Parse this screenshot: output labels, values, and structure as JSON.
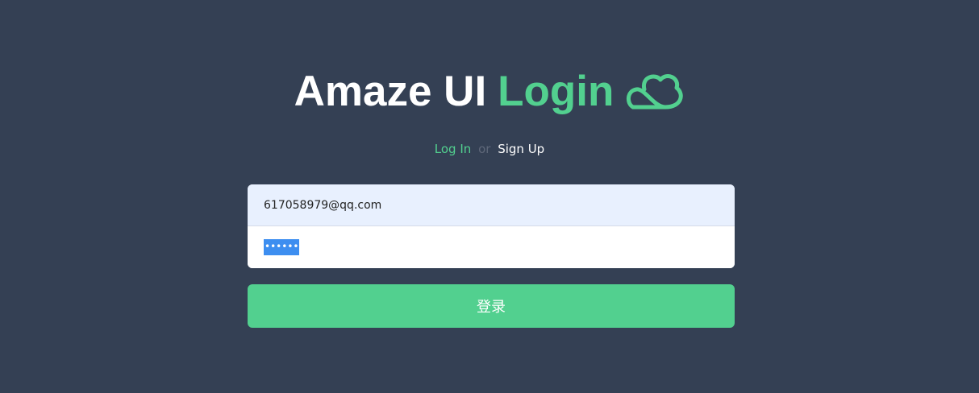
{
  "header": {
    "title_main": "Amaze UI",
    "title_accent": "Login",
    "icon": "cloud-icon"
  },
  "nav": {
    "login_label": "Log In",
    "separator": "or",
    "signup_label": "Sign Up"
  },
  "form": {
    "email_value": "617058979@qq.com",
    "password_mask": "••••••",
    "submit_label": "登录"
  },
  "colors": {
    "background": "#344054",
    "accent": "#52d08f",
    "autofill": "#e8f0fe",
    "selection": "#3d8ef0"
  }
}
